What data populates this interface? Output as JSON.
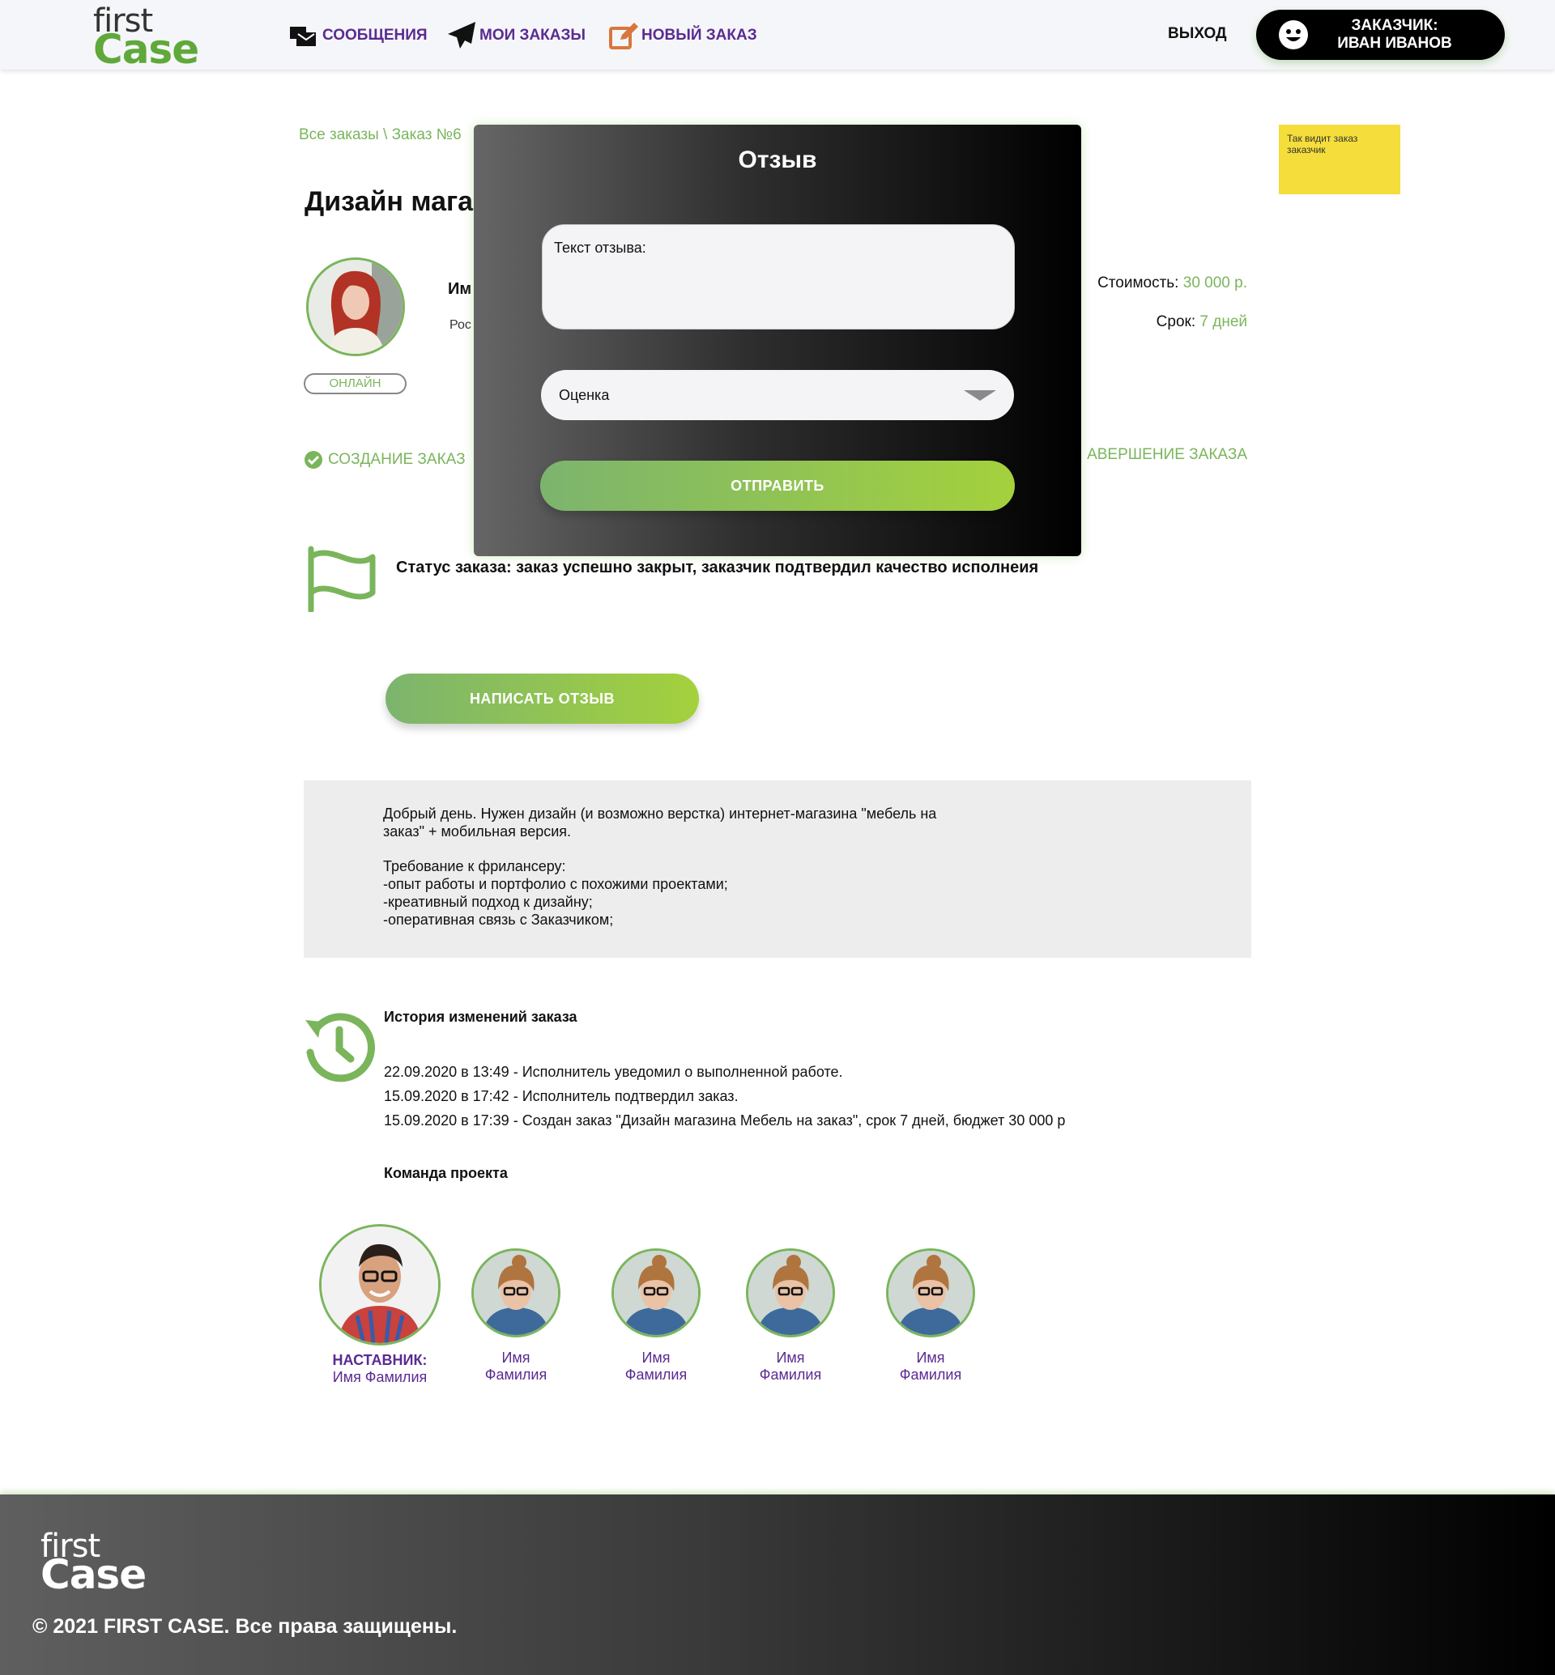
{
  "brand": {
    "logo_line1": "first",
    "logo_line2": "Case"
  },
  "header": {
    "nav": [
      {
        "label": "СООБЩЕНИЯ",
        "icon": "messages-icon"
      },
      {
        "label": "МОИ ЗАКАЗЫ",
        "icon": "paper-plane-icon"
      },
      {
        "label": "НОВЫЙ ЗАКАЗ",
        "icon": "edit-icon"
      }
    ],
    "exit_label": "ВЫХОД",
    "user_role": "ЗАКАЗЧИК:",
    "user_name": "ИВАН ИВАНОВ"
  },
  "note": {
    "text": "Так видит заказ заказчик"
  },
  "breadcrumb": "Все заказы \\ Заказ №6",
  "order": {
    "title_visible": "Дизайн мага",
    "online_label": "ОНЛАЙН",
    "name_visible": "Им",
    "city_visible": "Рос",
    "cost_label": "Стоимость:",
    "cost_value": "30 000 р.",
    "term_label": "Срок:",
    "term_value": "7 дней",
    "step_created": "СОЗДАНИЕ ЗАКАЗ",
    "step_finished": "АВЕРШЕНИЕ ЗАКАЗА",
    "status": "Статус заказа: заказ успешно закрыт, заказчик подтвердил качество исполнеия",
    "write_review_label": "НАПИСАТЬ ОТЗЫВ"
  },
  "description": {
    "p1": "Добрый день. Нужен дизайн (и возможно верстка) интернет-магазина \"мебель на\nзаказ\" + мобильная версия.",
    "p2": "Требование к фрилансеру:\n-опыт работы и портфолио с похожими проектами;\n-креативный подход к дизайну;\n-оперативная связь с Заказчиком;"
  },
  "history": {
    "title": "История изменений заказа",
    "items": [
      "22.09.2020 в 13:49 - Исполнитель уведомил о выполненной работе.",
      "15.09.2020 в 17:42 - Исполнитель подтвердил заказ.",
      "15.09.2020 в 17:39 - Создан заказ \"Дизайн магазина Мебель на заказ\", срок 7 дней, бюджет 30 000 р"
    ]
  },
  "team": {
    "title": "Команда проекта",
    "mentor_role": "НАСТАВНИК:",
    "mentor_name": "Имя Фамилия",
    "members": [
      {
        "first": "Имя",
        "last": "Фамилия"
      },
      {
        "first": "Имя",
        "last": "Фамилия"
      },
      {
        "first": "Имя",
        "last": "Фамилия"
      },
      {
        "first": "Имя",
        "last": "Фамилия"
      }
    ]
  },
  "footer": {
    "copyright": "© 2021 FIRST CASE. Все права защищены."
  },
  "modal": {
    "title": "Отзыв",
    "text_label": "Текст отзыва:",
    "rating_label": "Оценка",
    "submit_label": "ОТПРАВИТЬ"
  },
  "colors": {
    "accent_green": "#7ab55c",
    "nav_purple": "#5a2b91",
    "note_yellow": "#f5dd3b"
  }
}
